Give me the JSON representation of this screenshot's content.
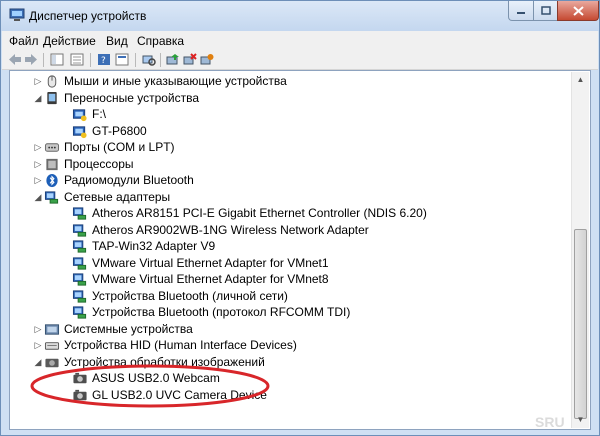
{
  "window": {
    "title": "Диспетчер устройств"
  },
  "menu": [
    {
      "label": "Файл"
    },
    {
      "label": "Действие"
    },
    {
      "label": "Вид"
    },
    {
      "label": "Справка"
    }
  ],
  "tree": [
    {
      "label": "Мыши и иные указывающие устройства",
      "level": 0,
      "expanded": false,
      "icon": "mouse-icon"
    },
    {
      "label": "Переносные устройства",
      "level": 0,
      "expanded": true,
      "icon": "portable-devices-icon"
    },
    {
      "label": "F:\\",
      "level": 1,
      "icon": "portable-device-icon"
    },
    {
      "label": "GT-P6800",
      "level": 1,
      "icon": "portable-device-icon"
    },
    {
      "label": "Порты (COM и LPT)",
      "level": 0,
      "expanded": false,
      "icon": "port-icon"
    },
    {
      "label": "Процессоры",
      "level": 0,
      "expanded": false,
      "icon": "processor-icon"
    },
    {
      "label": "Радиомодули Bluetooth",
      "level": 0,
      "expanded": false,
      "icon": "bluetooth-icon"
    },
    {
      "label": "Сетевые адаптеры",
      "level": 0,
      "expanded": true,
      "icon": "network-adapter-icon"
    },
    {
      "label": "Atheros AR8151 PCI-E Gigabit Ethernet Controller (NDIS 6.20)",
      "level": 1,
      "icon": "network-adapter-icon"
    },
    {
      "label": "Atheros AR9002WB-1NG Wireless Network Adapter",
      "level": 1,
      "icon": "network-adapter-icon"
    },
    {
      "label": "TAP-Win32 Adapter V9",
      "level": 1,
      "icon": "network-adapter-icon"
    },
    {
      "label": "VMware Virtual Ethernet Adapter for VMnet1",
      "level": 1,
      "icon": "network-adapter-icon"
    },
    {
      "label": "VMware Virtual Ethernet Adapter for VMnet8",
      "level": 1,
      "icon": "network-adapter-icon"
    },
    {
      "label": "Устройства Bluetooth (личной сети)",
      "level": 1,
      "icon": "network-adapter-icon"
    },
    {
      "label": "Устройства Bluetooth (протокол RFCOMM TDI)",
      "level": 1,
      "icon": "network-adapter-icon"
    },
    {
      "label": "Системные устройства",
      "level": 0,
      "expanded": false,
      "icon": "system-device-icon"
    },
    {
      "label": "Устройства HID (Human Interface Devices)",
      "level": 0,
      "expanded": false,
      "icon": "hid-icon"
    },
    {
      "label": "Устройства обработки изображений",
      "level": 0,
      "expanded": true,
      "icon": "imaging-device-icon"
    },
    {
      "label": "ASUS USB2.0 Webcam",
      "level": 1,
      "icon": "camera-icon"
    },
    {
      "label": "GL USB2.0 UVC Camera Device",
      "level": 1,
      "icon": "camera-icon"
    }
  ],
  "watermark": "SRU",
  "colors": {
    "annotation": "#d8262a",
    "window_frame": "#c8dbf2",
    "titlebar_close": "#c8402a"
  }
}
